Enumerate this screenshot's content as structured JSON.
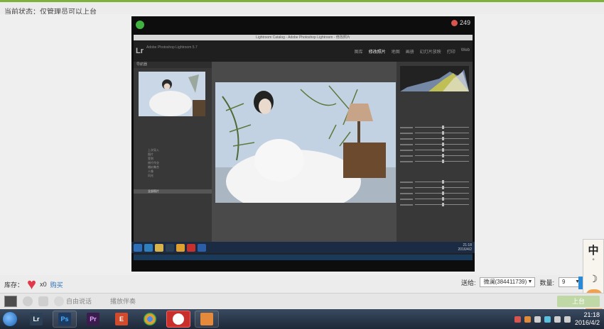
{
  "header": {
    "status_text": "当前状态：仅管理员可以上台",
    "accent_color": "#7fb23d"
  },
  "video": {
    "viewer_icon": "viewer-count-icon",
    "viewer_count": "249",
    "lightroom": {
      "window_title": "Lightroom Catalog - Adobe Photoshop Lightroom - 修改照片",
      "logo": "Lr",
      "app_name": "Adobe Photoshop Lightroom 5.7",
      "modules": [
        "图库",
        "修改照片",
        "地图",
        "画册",
        "幻灯片放映",
        "打印",
        "Web"
      ],
      "active_module": "修改照片",
      "navigator_label": "导航器",
      "collections": [
        "全部照片",
        "上次导入",
        "图片",
        "签到",
        "修片作业",
        "婚纱集合",
        "人像",
        "风光"
      ],
      "selected_collection": "全部照片",
      "photo_subject": "bride-in-white-dress"
    },
    "inner_clock": {
      "time": "21:18",
      "date": "2016/4/2"
    }
  },
  "stock": {
    "label": "库存：",
    "icon": "heart-icon",
    "count": "x0",
    "buy_label": "购买"
  },
  "gift": {
    "to_label": "送给:",
    "recipient": "微澜(384411739)",
    "qty_label": "数量:",
    "qty": "9"
  },
  "side_widget": {
    "char": "中",
    "dots": "°",
    "moon": "☽"
  },
  "toolbar": {
    "free_talk": "自由说话",
    "play_accompaniment": "播放伴奏",
    "onstage": "上台"
  },
  "taskbar": {
    "apps": [
      {
        "name": "lightroom",
        "glyph": "Lr",
        "color": "#2b3f55"
      },
      {
        "name": "photoshop",
        "glyph": "Ps",
        "color": "#1d3b63"
      },
      {
        "name": "premiere",
        "glyph": "Pr",
        "color": "#3a1d4d"
      },
      {
        "name": "evernote-like",
        "glyph": "E",
        "color": "#d24a2c"
      },
      {
        "name": "chrome",
        "glyph": "",
        "color": "#e0a030"
      },
      {
        "name": "yy-record",
        "glyph": "",
        "color": "#c9302c"
      },
      {
        "name": "yy-users",
        "glyph": "",
        "color": "#e58a3a"
      }
    ],
    "time": "21:18",
    "date": "2016/4/2"
  }
}
